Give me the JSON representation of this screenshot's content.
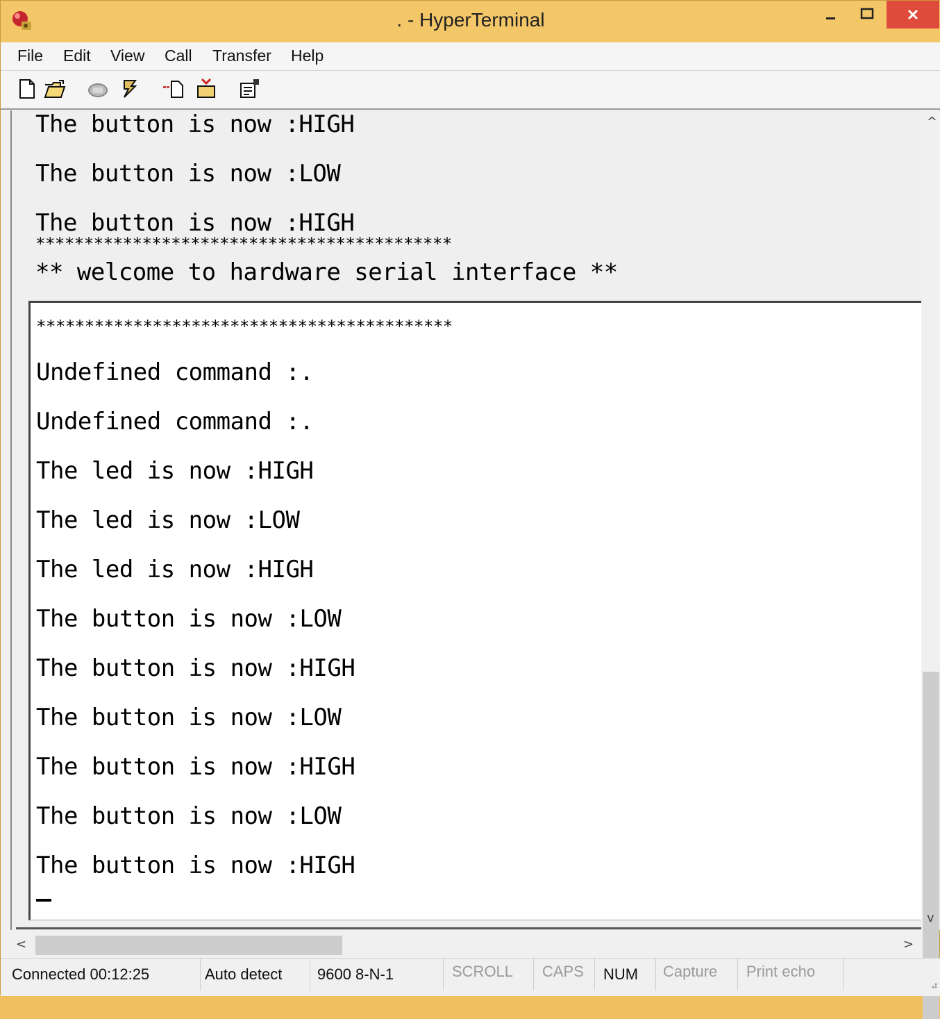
{
  "window": {
    "title": ". - HyperTerminal",
    "controls": {
      "minimize": "–",
      "maximize": "□",
      "close": "✕"
    }
  },
  "menu": [
    "File",
    "Edit",
    "View",
    "Call",
    "Transfer",
    "Help"
  ],
  "toolbar": {
    "icons": [
      "new-document-icon",
      "open-folder-icon",
      "phone-icon",
      "disconnect-icon",
      "send-icon",
      "receive-icon",
      "properties-icon"
    ]
  },
  "terminal": {
    "upper_lines": [
      "The button is now :HIGH",
      "The button is now :LOW",
      "The button is now :HIGH",
      "*******************************************",
      "** welcome to hardware serial interface **"
    ],
    "lower_lines": [
      "*******************************************",
      "Undefined command :.",
      "Undefined command :.",
      "The led is now :HIGH",
      "The led is now :LOW",
      "The led is now :HIGH",
      "The button is now :LOW",
      "The button is now :HIGH",
      "The button is now :LOW",
      "The button is now :HIGH",
      "The button is now :LOW",
      "The button is now :HIGH"
    ]
  },
  "scrollbars": {
    "up": "^",
    "down": "v",
    "left": "<",
    "right": ">"
  },
  "status": {
    "connected": "Connected 00:12:25",
    "detect": "Auto detect",
    "settings": "9600 8-N-1",
    "scroll": "SCROLL",
    "caps": "CAPS",
    "num": "NUM",
    "capture": "Capture",
    "print_echo": "Print echo"
  },
  "colors": {
    "titlebar": "#f3c668",
    "close": "#e04a3a"
  }
}
